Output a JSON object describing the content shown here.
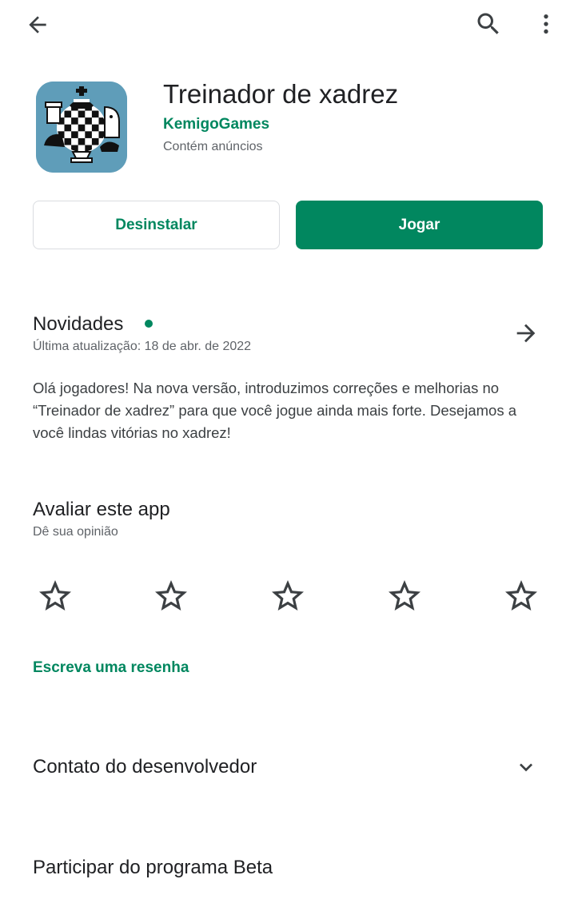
{
  "header": {
    "back_icon": "arrow-back-icon",
    "search_icon": "search-icon",
    "more_icon": "more-vert-icon"
  },
  "app": {
    "icon": "chess-app-icon",
    "title": "Treinador de xadrez",
    "developer": "KemigoGames",
    "ads_note": "Contém anúncios"
  },
  "actions": {
    "uninstall_label": "Desinstalar",
    "play_label": "Jogar",
    "accent_color": "#01875f"
  },
  "whats_new": {
    "title": "Novidades",
    "last_update": "Última atualização: 18 de abr. de 2022",
    "body": "Olá jogadores! Na nova versão, introduzimos correções e melhorias no “Treinador de xadrez” para que você jogue ainda mais forte. Desejamos a você lindas vitórias no xadrez!",
    "arrow_icon": "arrow-forward-icon"
  },
  "rate": {
    "title": "Avaliar este app",
    "subtitle": "Dê sua opinião",
    "star_count": 5,
    "star_icon": "star-outline-icon",
    "write_review_label": "Escreva uma resenha"
  },
  "developer_contact": {
    "title": "Contato do desenvolvedor",
    "chevron_icon": "chevron-down-icon"
  },
  "beta": {
    "title": "Participar do programa Beta"
  }
}
